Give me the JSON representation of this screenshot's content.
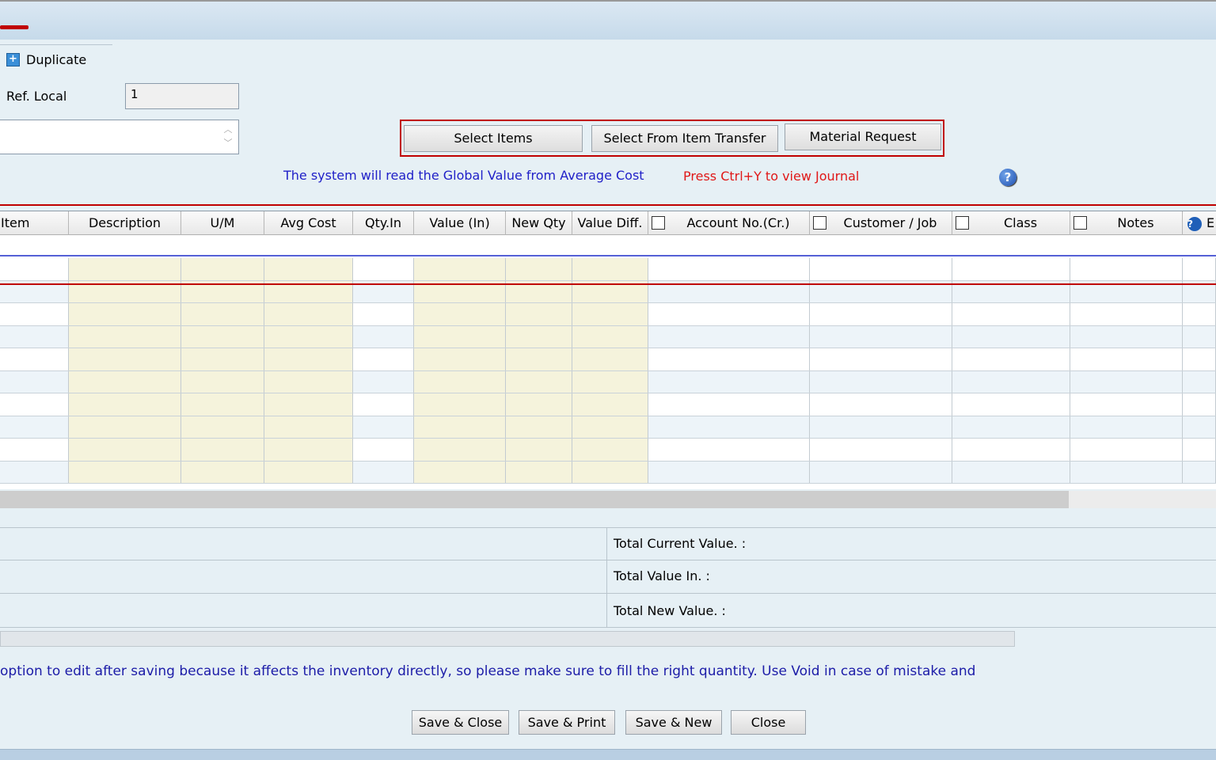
{
  "header": {
    "duplicate_label": "Duplicate",
    "ref_local_label": "Ref. Local",
    "ref_local_value": "1"
  },
  "actions": {
    "select_items": "Select Items",
    "select_from_transfer": "Select From Item Transfer",
    "material_request": "Material Request"
  },
  "hints": {
    "global_value": "The system will read the Global Value from Average Cost",
    "journal": "Press Ctrl+Y to view Journal"
  },
  "grid": {
    "columns": [
      "Item",
      "Description",
      "U/M",
      "Avg Cost",
      "Qty.In",
      "Value (In)",
      "New Qty",
      "Value Diff.",
      "Account No.(Cr.)",
      "Customer / Job",
      "Class",
      "Notes",
      "E"
    ]
  },
  "totals": {
    "current_value": "Total Current Value. :",
    "value_in": "Total Value In. :",
    "new_value": "Total New Value. :"
  },
  "warning": "option to edit after saving because it affects the inventory directly, so please make sure to fill the right quantity. Use Void in case of mistake and",
  "footer": {
    "save_close": "Save & Close",
    "save_print": "Save & Print",
    "save_new": "Save & New",
    "close": "Close"
  },
  "colors": {
    "highlight_red": "#c00000",
    "hint_blue": "#2020c8",
    "hint_red": "#e01818",
    "readonly_cell": "#f5f3dc"
  }
}
